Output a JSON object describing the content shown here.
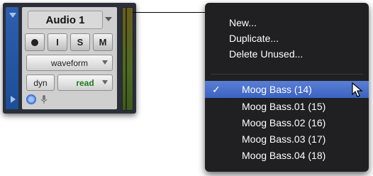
{
  "track": {
    "name": "Audio 1",
    "buttons": {
      "record_label": "",
      "input_label": "I",
      "solo_label": "S",
      "mute_label": "M"
    },
    "view_selector": "waveform",
    "automation_label": "dyn",
    "automation_mode": "read"
  },
  "menu": {
    "actions": [
      "New...",
      "Duplicate...",
      "Delete Unused..."
    ],
    "playlists": [
      {
        "label": "Moog Bass (14)",
        "checked": true
      },
      {
        "label": "Moog Bass.01 (15)",
        "checked": false
      },
      {
        "label": "Moog Bass.02 (16)",
        "checked": false
      },
      {
        "label": "Moog Bass.03 (17)",
        "checked": false
      },
      {
        "label": "Moog Bass.04 (18)",
        "checked": false
      }
    ],
    "check_glyph": "✓"
  },
  "colors": {
    "menu_bg": "#141416",
    "highlight": "#4a70cc",
    "track_strip": "#2c5fae",
    "meter": "#5a6a22",
    "read_text": "#1f7a1f"
  },
  "icons": [
    "disclosure-triangle-icon",
    "record-icon",
    "arrow-cursor-icon",
    "voice-icon",
    "mic-icon"
  ]
}
